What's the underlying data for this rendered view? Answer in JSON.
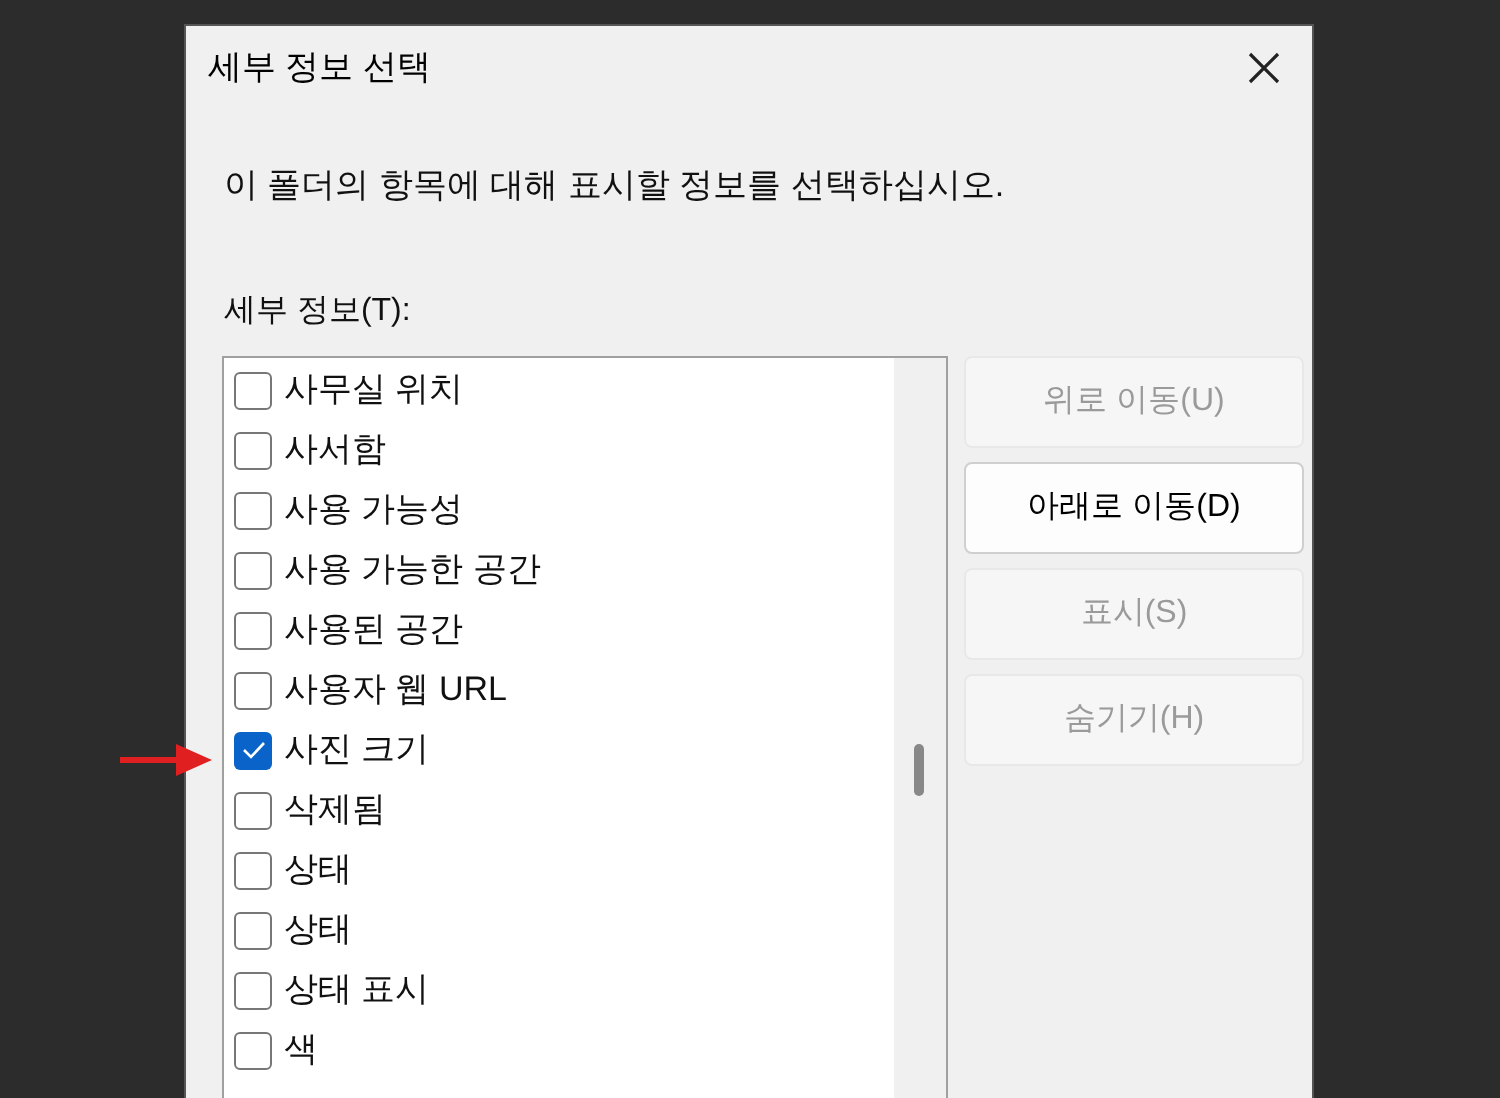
{
  "window": {
    "title": "세부 정보 선택"
  },
  "description": "이 폴더의 항목에 대해 표시할 정보를 선택하십시오.",
  "details_label": "세부 정보(T):",
  "items": [
    {
      "label": "사무실 위치",
      "checked": false
    },
    {
      "label": "사서함",
      "checked": false
    },
    {
      "label": "사용 가능성",
      "checked": false
    },
    {
      "label": "사용 가능한 공간",
      "checked": false
    },
    {
      "label": "사용된 공간",
      "checked": false
    },
    {
      "label": "사용자 웹 URL",
      "checked": false
    },
    {
      "label": "사진 크기",
      "checked": true
    },
    {
      "label": "삭제됨",
      "checked": false
    },
    {
      "label": "상태",
      "checked": false
    },
    {
      "label": "상태",
      "checked": false
    },
    {
      "label": "상태 표시",
      "checked": false
    },
    {
      "label": "색",
      "checked": false
    }
  ],
  "buttons": [
    {
      "label": "위로 이동(U)",
      "disabled": true
    },
    {
      "label": "아래로 이동(D)",
      "disabled": false
    },
    {
      "label": "표시(S)",
      "disabled": true
    },
    {
      "label": "숨기기(H)",
      "disabled": true
    }
  ]
}
